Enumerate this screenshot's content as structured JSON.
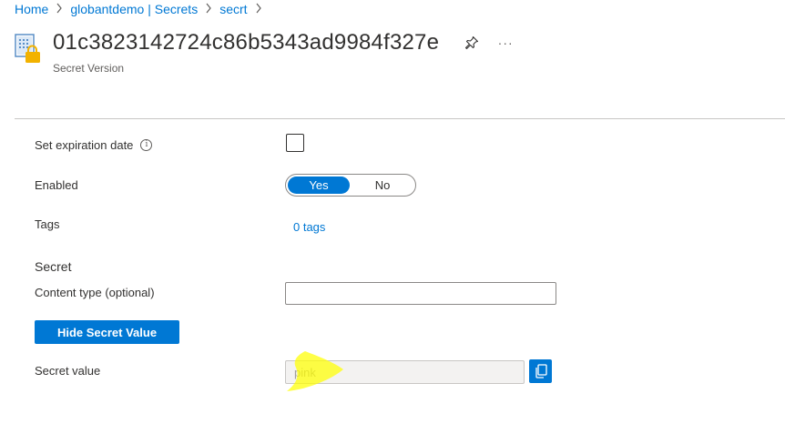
{
  "breadcrumb": [
    {
      "label": "Home"
    },
    {
      "label": "globantdemo | Secrets"
    },
    {
      "label": "secrt"
    }
  ],
  "header": {
    "title": "01c3823142724c86b5343ad9984f327e",
    "subtitle": "Secret Version",
    "more_label": "···"
  },
  "form": {
    "expiration_label": "Set expiration date",
    "expiration_checked": false,
    "enabled_label": "Enabled",
    "enabled_options": {
      "yes": "Yes",
      "no": "No"
    },
    "enabled_selected": "Yes",
    "tags_label": "Tags",
    "tags_value": "0 tags",
    "secret_section": "Secret",
    "content_type_label": "Content type (optional)",
    "content_type_value": "",
    "hide_button_label": "Hide Secret Value",
    "secret_value_label": "Secret value",
    "secret_value": "pink"
  },
  "colors": {
    "accent": "#0078d4",
    "highlight": "#ffff00"
  },
  "icons": {
    "resource": "key-vault-secret-icon",
    "pin": "pin-icon",
    "info": "info-icon",
    "copy": "copy-icon"
  }
}
